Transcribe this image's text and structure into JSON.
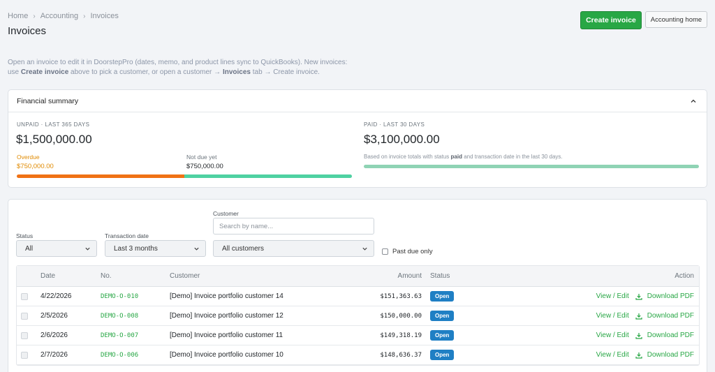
{
  "breadcrumb": [
    "Home",
    "Accounting",
    "Invoices"
  ],
  "page_title": "Invoices",
  "actions": {
    "create_label": "Create invoice",
    "home_label": "Accounting home"
  },
  "intro": {
    "p1": "Open an invoice to edit it in DoorstepPro (dates, memo, and product lines sync to QuickBooks). New invoices: use ",
    "b1": "Create invoice",
    "p2": " above to pick a customer, or open a customer → ",
    "b2": "Invoices",
    "p3": " tab → Create invoice."
  },
  "financial_summary": {
    "title": "Financial summary",
    "unpaid": {
      "label": "UNPAID · LAST 365 DAYS",
      "amount": "$1,500,000.00",
      "overdue_label": "Overdue",
      "overdue_amount": "$750,000.00",
      "notdue_label": "Not due yet",
      "notdue_amount": "$750,000.00",
      "overdue_fraction": 0.5
    },
    "paid": {
      "label": "PAID · LAST 30 DAYS",
      "amount": "$3,100,000.00",
      "note_p1": "Based on invoice totals with status ",
      "note_b": "paid",
      "note_p2": " and transaction date in the last 30 days.",
      "fraction": 1.0
    }
  },
  "filters": {
    "status": {
      "label": "Status",
      "value": "All"
    },
    "transaction_date": {
      "label": "Transaction date",
      "value": "Last 3 months"
    },
    "customer": {
      "label": "Customer",
      "placeholder": "Search by name...",
      "value": "All customers"
    },
    "past_due_label": "Past due only"
  },
  "table": {
    "columns": {
      "date": "Date",
      "no": "No.",
      "customer": "Customer",
      "amount": "Amount",
      "status": "Status",
      "action": "Action"
    },
    "view_label": "View / Edit",
    "download_label": "Download PDF",
    "rows": [
      {
        "date": "4/22/2026",
        "no": "DEMO-O-010",
        "customer": "[Demo] Invoice portfolio customer 14",
        "amount": "$151,363.63",
        "status": "Open"
      },
      {
        "date": "2/5/2026",
        "no": "DEMO-O-008",
        "customer": "[Demo] Invoice portfolio customer 12",
        "amount": "$150,000.00",
        "status": "Open"
      },
      {
        "date": "2/6/2026",
        "no": "DEMO-O-007",
        "customer": "[Demo] Invoice portfolio customer 11",
        "amount": "$149,318.19",
        "status": "Open"
      },
      {
        "date": "2/7/2026",
        "no": "DEMO-O-006",
        "customer": "[Demo] Invoice portfolio customer 10",
        "amount": "$148,636.37",
        "status": "Open"
      }
    ]
  },
  "colors": {
    "accent": "#28a745",
    "open_badge": "#1f7fc4",
    "paid_badge": "#1e5c2f",
    "overdue": "#f07215",
    "overdue_text": "#e08a00",
    "notdue": "#4fd1a2",
    "paid_bar": "#8fd3b4"
  }
}
